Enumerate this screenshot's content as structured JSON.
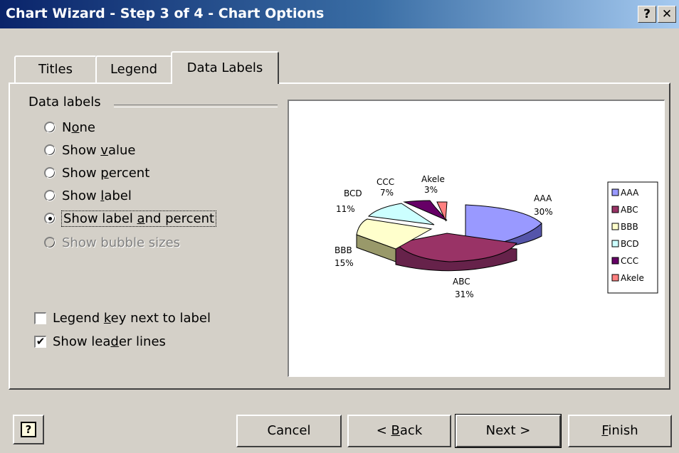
{
  "window": {
    "title": "Chart Wizard - Step 3 of 4 - Chart Options",
    "help_glyph": "?",
    "close_glyph": "✕"
  },
  "tabs": [
    {
      "label": "Titles",
      "active": false
    },
    {
      "label": "Legend",
      "active": false
    },
    {
      "label": "Data Labels",
      "active": true
    }
  ],
  "data_labels": {
    "group_label": "Data labels",
    "options": [
      {
        "label": "None",
        "checked": false,
        "disabled": false
      },
      {
        "label": "Show value",
        "checked": false,
        "disabled": false
      },
      {
        "label": "Show percent",
        "checked": false,
        "disabled": false
      },
      {
        "label": "Show label",
        "checked": false,
        "disabled": false
      },
      {
        "label": "Show label and percent",
        "checked": true,
        "disabled": false
      },
      {
        "label": "Show bubble sizes",
        "checked": false,
        "disabled": true
      }
    ],
    "checkboxes": [
      {
        "label": "Legend key next to label",
        "checked": false
      },
      {
        "label": "Show leader lines",
        "checked": true
      }
    ]
  },
  "chart_data": {
    "type": "pie",
    "categories": [
      "AAA",
      "ABC",
      "BBB",
      "BCD",
      "CCC",
      "Akele"
    ],
    "values": [
      30,
      31,
      15,
      11,
      7,
      3
    ],
    "data_labels": [
      {
        "name": "AAA",
        "percent": "30%"
      },
      {
        "name": "ABC",
        "percent": "31%"
      },
      {
        "name": "BBB",
        "percent": "15%"
      },
      {
        "name": "BCD",
        "percent": "11%"
      },
      {
        "name": "CCC",
        "percent": "7%"
      },
      {
        "name": "Akele",
        "percent": "3%"
      }
    ],
    "colors": [
      "#9999ff",
      "#993366",
      "#ffffcc",
      "#ccffff",
      "#660066",
      "#ff8080"
    ],
    "legend": [
      "AAA",
      "ABC",
      "BBB",
      "BCD",
      "CCC",
      "Akele"
    ],
    "legend_position": "right",
    "style": "3-D exploded pie"
  },
  "buttons": {
    "help_glyph": "?",
    "cancel": "Cancel",
    "back": "< Back",
    "next": "Next >",
    "finish": "Finish"
  }
}
